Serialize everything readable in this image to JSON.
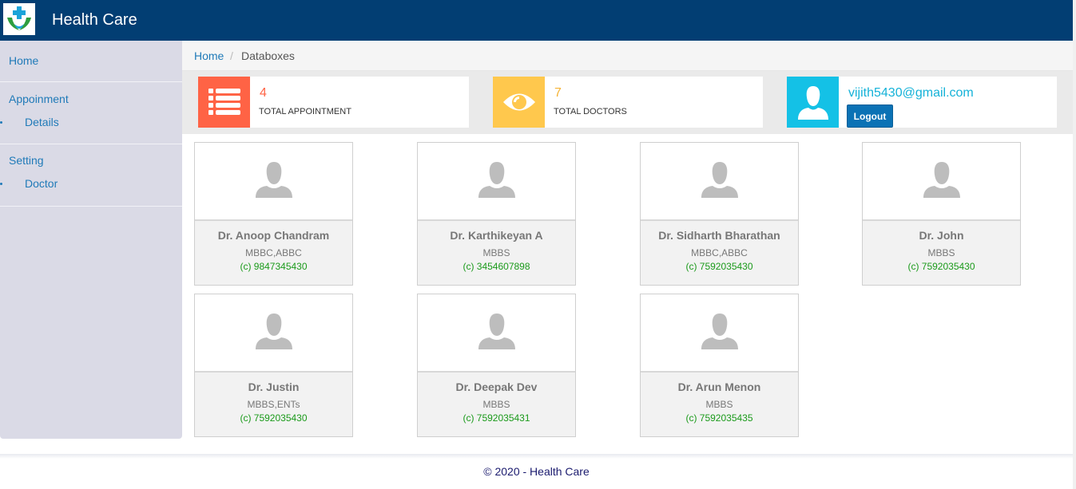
{
  "app": {
    "title": "Health Care"
  },
  "sidebar": {
    "items": [
      {
        "label": "Home"
      },
      {
        "label": "Appoinment",
        "sub": [
          {
            "label": "Details"
          }
        ]
      },
      {
        "label": "Setting",
        "sub": [
          {
            "label": "Doctor"
          }
        ]
      }
    ]
  },
  "breadcrumb": {
    "home": "Home",
    "separator": "/",
    "current": "Databoxes"
  },
  "stats": [
    {
      "value": "4",
      "label": "TOTAL APPOINTMENT",
      "icon": "list-icon",
      "color": "#ff6345"
    },
    {
      "value": "7",
      "label": "TOTAL DOCTORS",
      "icon": "eye-icon",
      "color": "#ffc84d"
    }
  ],
  "user": {
    "email": "vijith5430@gmail.com",
    "logout_label": "Logout",
    "icon": "user-icon",
    "color": "#14c1e6"
  },
  "doctors": [
    {
      "name": "Dr. Anoop Chandram",
      "qualification": "MBBC,ABBC",
      "phone": "(c) 9847345430"
    },
    {
      "name": "Dr. Karthikeyan A",
      "qualification": "MBBS",
      "phone": "(c) 3454607898"
    },
    {
      "name": "Dr. Sidharth Bharathan",
      "qualification": "MBBC,ABBC",
      "phone": "(c) 7592035430"
    },
    {
      "name": "Dr. John",
      "qualification": "MBBS",
      "phone": "(c) 7592035430"
    },
    {
      "name": "Dr. Justin",
      "qualification": "MBBS,ENTs",
      "phone": "(c) 7592035430"
    },
    {
      "name": "Dr. Deepak Dev",
      "qualification": "MBBS",
      "phone": "(c) 7592035431"
    },
    {
      "name": "Dr. Arun Menon",
      "qualification": "MBBS",
      "phone": "(c) 7592035435"
    }
  ],
  "footer": {
    "text": "© 2020 - Health Care"
  },
  "colors": {
    "header": "#023e73",
    "sidebar": "#dadae6",
    "link": "#1f7ab8",
    "phone": "#1a9a1a"
  }
}
